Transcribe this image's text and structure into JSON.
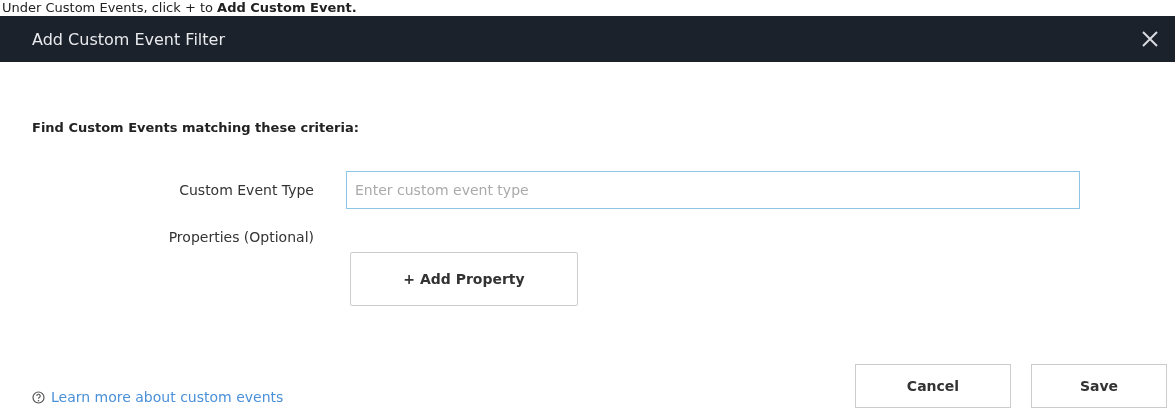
{
  "caption": "Under Custom Events, click + to **Add Custom Event.**",
  "dialog": {
    "title": "Add Custom Event Filter",
    "heading": "Find Custom Events matching these criteria:",
    "fields": [
      {
        "label": "Custom Event Type",
        "placeholder": "Enter custom event type"
      }
    ],
    "properties_label": "Properties (Optional)",
    "add_button": "+ Add Property",
    "help_link": "Learn more about custom events",
    "buttons": [
      "Cancel",
      "Save"
    ]
  }
}
